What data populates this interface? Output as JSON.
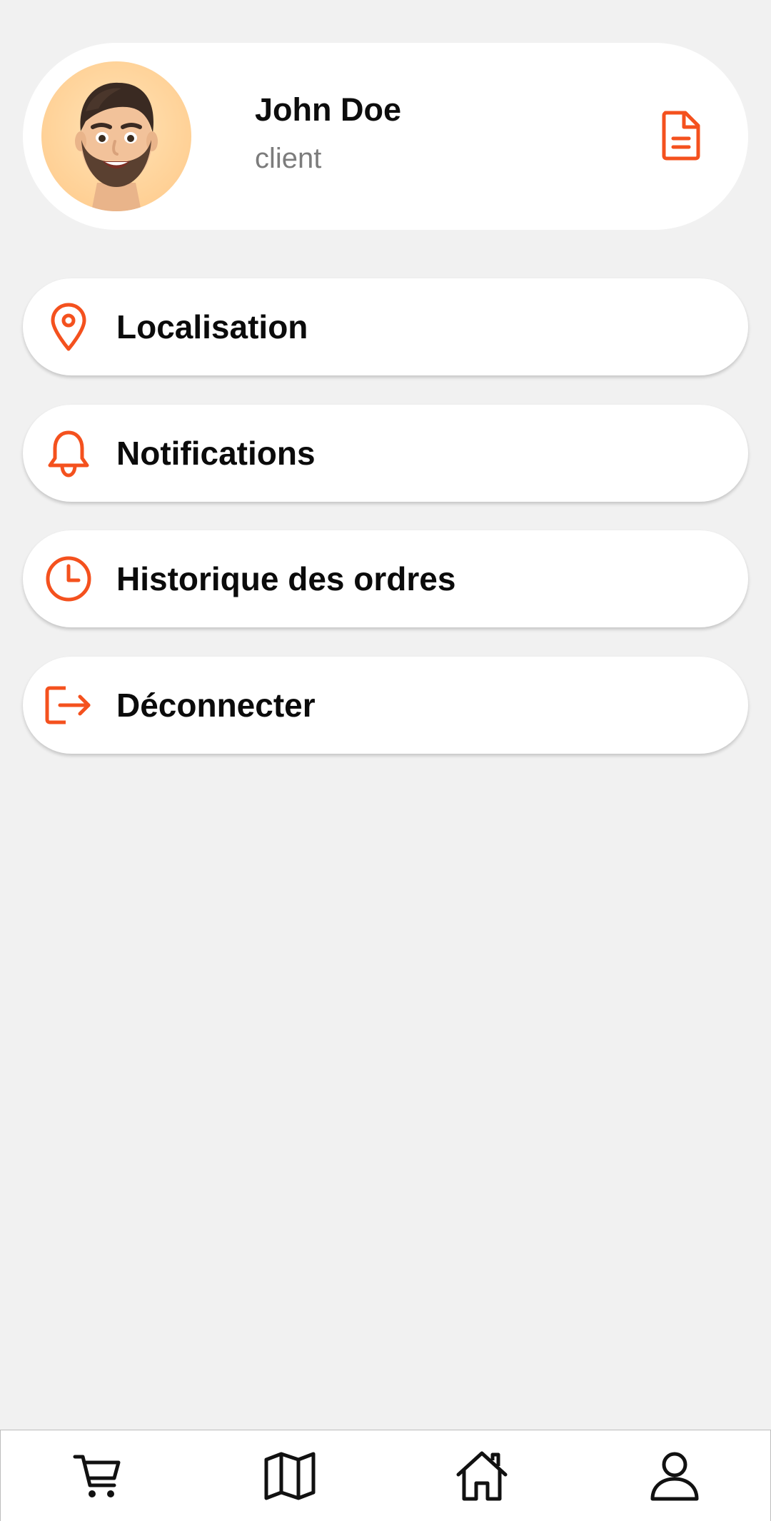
{
  "profile": {
    "name": "John Doe",
    "role": "client",
    "avatar_icon": "memoji-avatar",
    "action_icon": "document-icon"
  },
  "menu": {
    "items": [
      {
        "label": "Localisation",
        "icon": "map-pin-icon"
      },
      {
        "label": "Notifications",
        "icon": "bell-icon"
      },
      {
        "label": "Historique des ordres",
        "icon": "clock-icon"
      },
      {
        "label": "Déconnecter",
        "icon": "logout-icon"
      }
    ]
  },
  "bottom_nav": {
    "items": [
      {
        "icon": "cart-icon"
      },
      {
        "icon": "map-icon"
      },
      {
        "icon": "home-icon"
      },
      {
        "icon": "user-icon"
      }
    ]
  },
  "colors": {
    "accent": "#f4511e",
    "background": "#f1f1f1",
    "card": "#ffffff",
    "text": "#0b0b0b",
    "muted": "#7c7c7c"
  }
}
